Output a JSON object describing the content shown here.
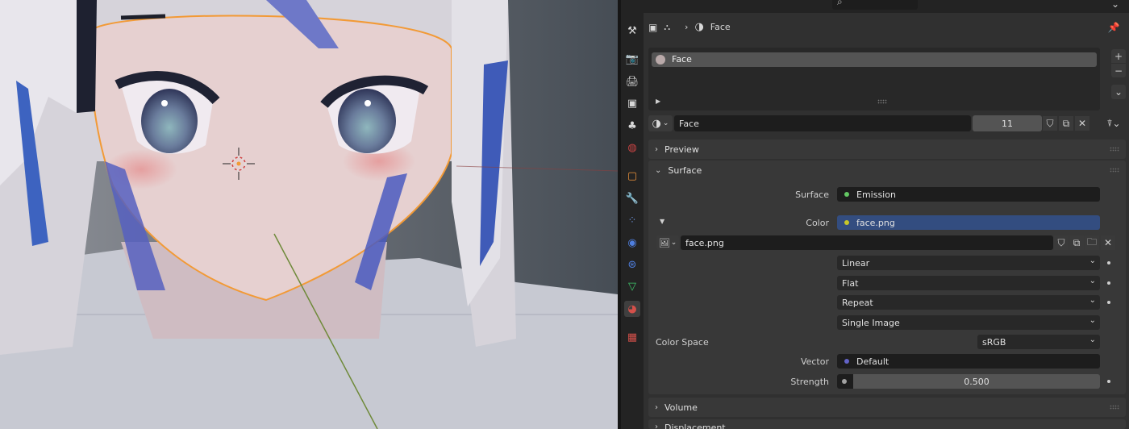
{
  "header": {
    "search_icon": "search-icon",
    "breadcrumb": {
      "item": "Face"
    }
  },
  "slots": {
    "items": [
      {
        "name": "Face"
      }
    ]
  },
  "material": {
    "name": "Face",
    "users": "11"
  },
  "panels": {
    "preview": "Preview",
    "surface": "Surface",
    "volume": "Volume",
    "displacement": "Displacement"
  },
  "surface": {
    "surface_label": "Surface",
    "surface_value": "Emission",
    "color_label": "Color",
    "color_value": "face.png",
    "image_name": "face.png",
    "interpolation": "Linear",
    "projection": "Flat",
    "extension": "Repeat",
    "source": "Single Image",
    "color_space_label": "Color Space",
    "color_space_value": "sRGB",
    "vector_label": "Vector",
    "vector_value": "Default",
    "strength_label": "Strength",
    "strength_value": "0.500"
  },
  "colors": {
    "emission_socket": "#63c763",
    "color_socket": "#c7c729",
    "vector_socket": "#6363c7",
    "strength_socket": "#a1a1a1",
    "accent_blue": "#334d80"
  }
}
